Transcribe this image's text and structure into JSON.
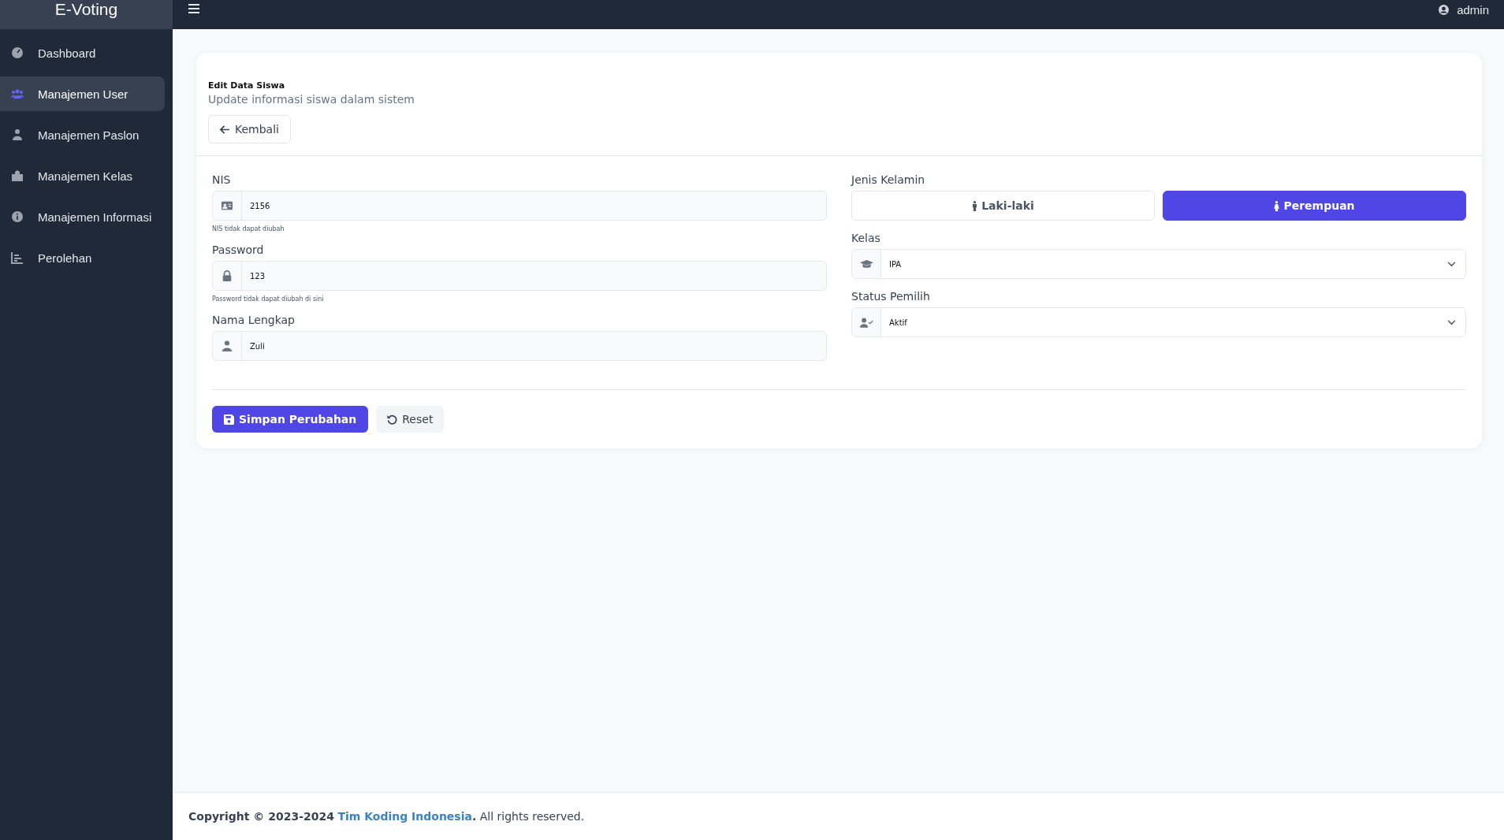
{
  "brand": "E-Voting",
  "sidebar": {
    "items": [
      {
        "label": "Dashboard",
        "kind": "gauge",
        "selected": false
      },
      {
        "label": "Manajemen User",
        "kind": "users",
        "selected": true
      },
      {
        "label": "Manajemen Paslon",
        "kind": "person",
        "selected": false
      },
      {
        "label": "Manajemen Kelas",
        "kind": "school",
        "selected": false
      },
      {
        "label": "Manajemen Informasi",
        "kind": "info",
        "selected": false
      },
      {
        "label": "Perolehan",
        "kind": "chart",
        "selected": false
      }
    ]
  },
  "user": "admin",
  "card": {
    "title": "Edit Data Siswa",
    "subtitle": "Update informasi siswa dalam sistem",
    "back": "Kembali"
  },
  "left_fields": [
    {
      "label": "NIS",
      "kind": "idcard",
      "value": "2156",
      "hint": "NIS tidak dapat diubah"
    },
    {
      "label": "Password",
      "kind": "lock",
      "value": "123",
      "hint": "Password tidak dapat diubah di sini"
    },
    {
      "label": "Nama Lengkap",
      "kind": "user",
      "value": "Zuli"
    }
  ],
  "gender": {
    "label": "Jenis Kelamin",
    "options": [
      {
        "label": "Laki-laki",
        "selected": false
      },
      {
        "label": "Perempuan",
        "selected": true
      }
    ]
  },
  "selects": [
    {
      "label": "Kelas",
      "kind": "cap",
      "value": "IPA"
    },
    {
      "label": "Status Pemilih",
      "kind": "usercheck",
      "value": "Aktif"
    }
  ],
  "buttons": {
    "save": "Simpan Perubahan",
    "reset": "Reset"
  },
  "footer": {
    "prefix": "Copyright © 2023-2024",
    "link": "Tim Koding Indonesia",
    "suffix": "**.** All rights reserved."
  }
}
